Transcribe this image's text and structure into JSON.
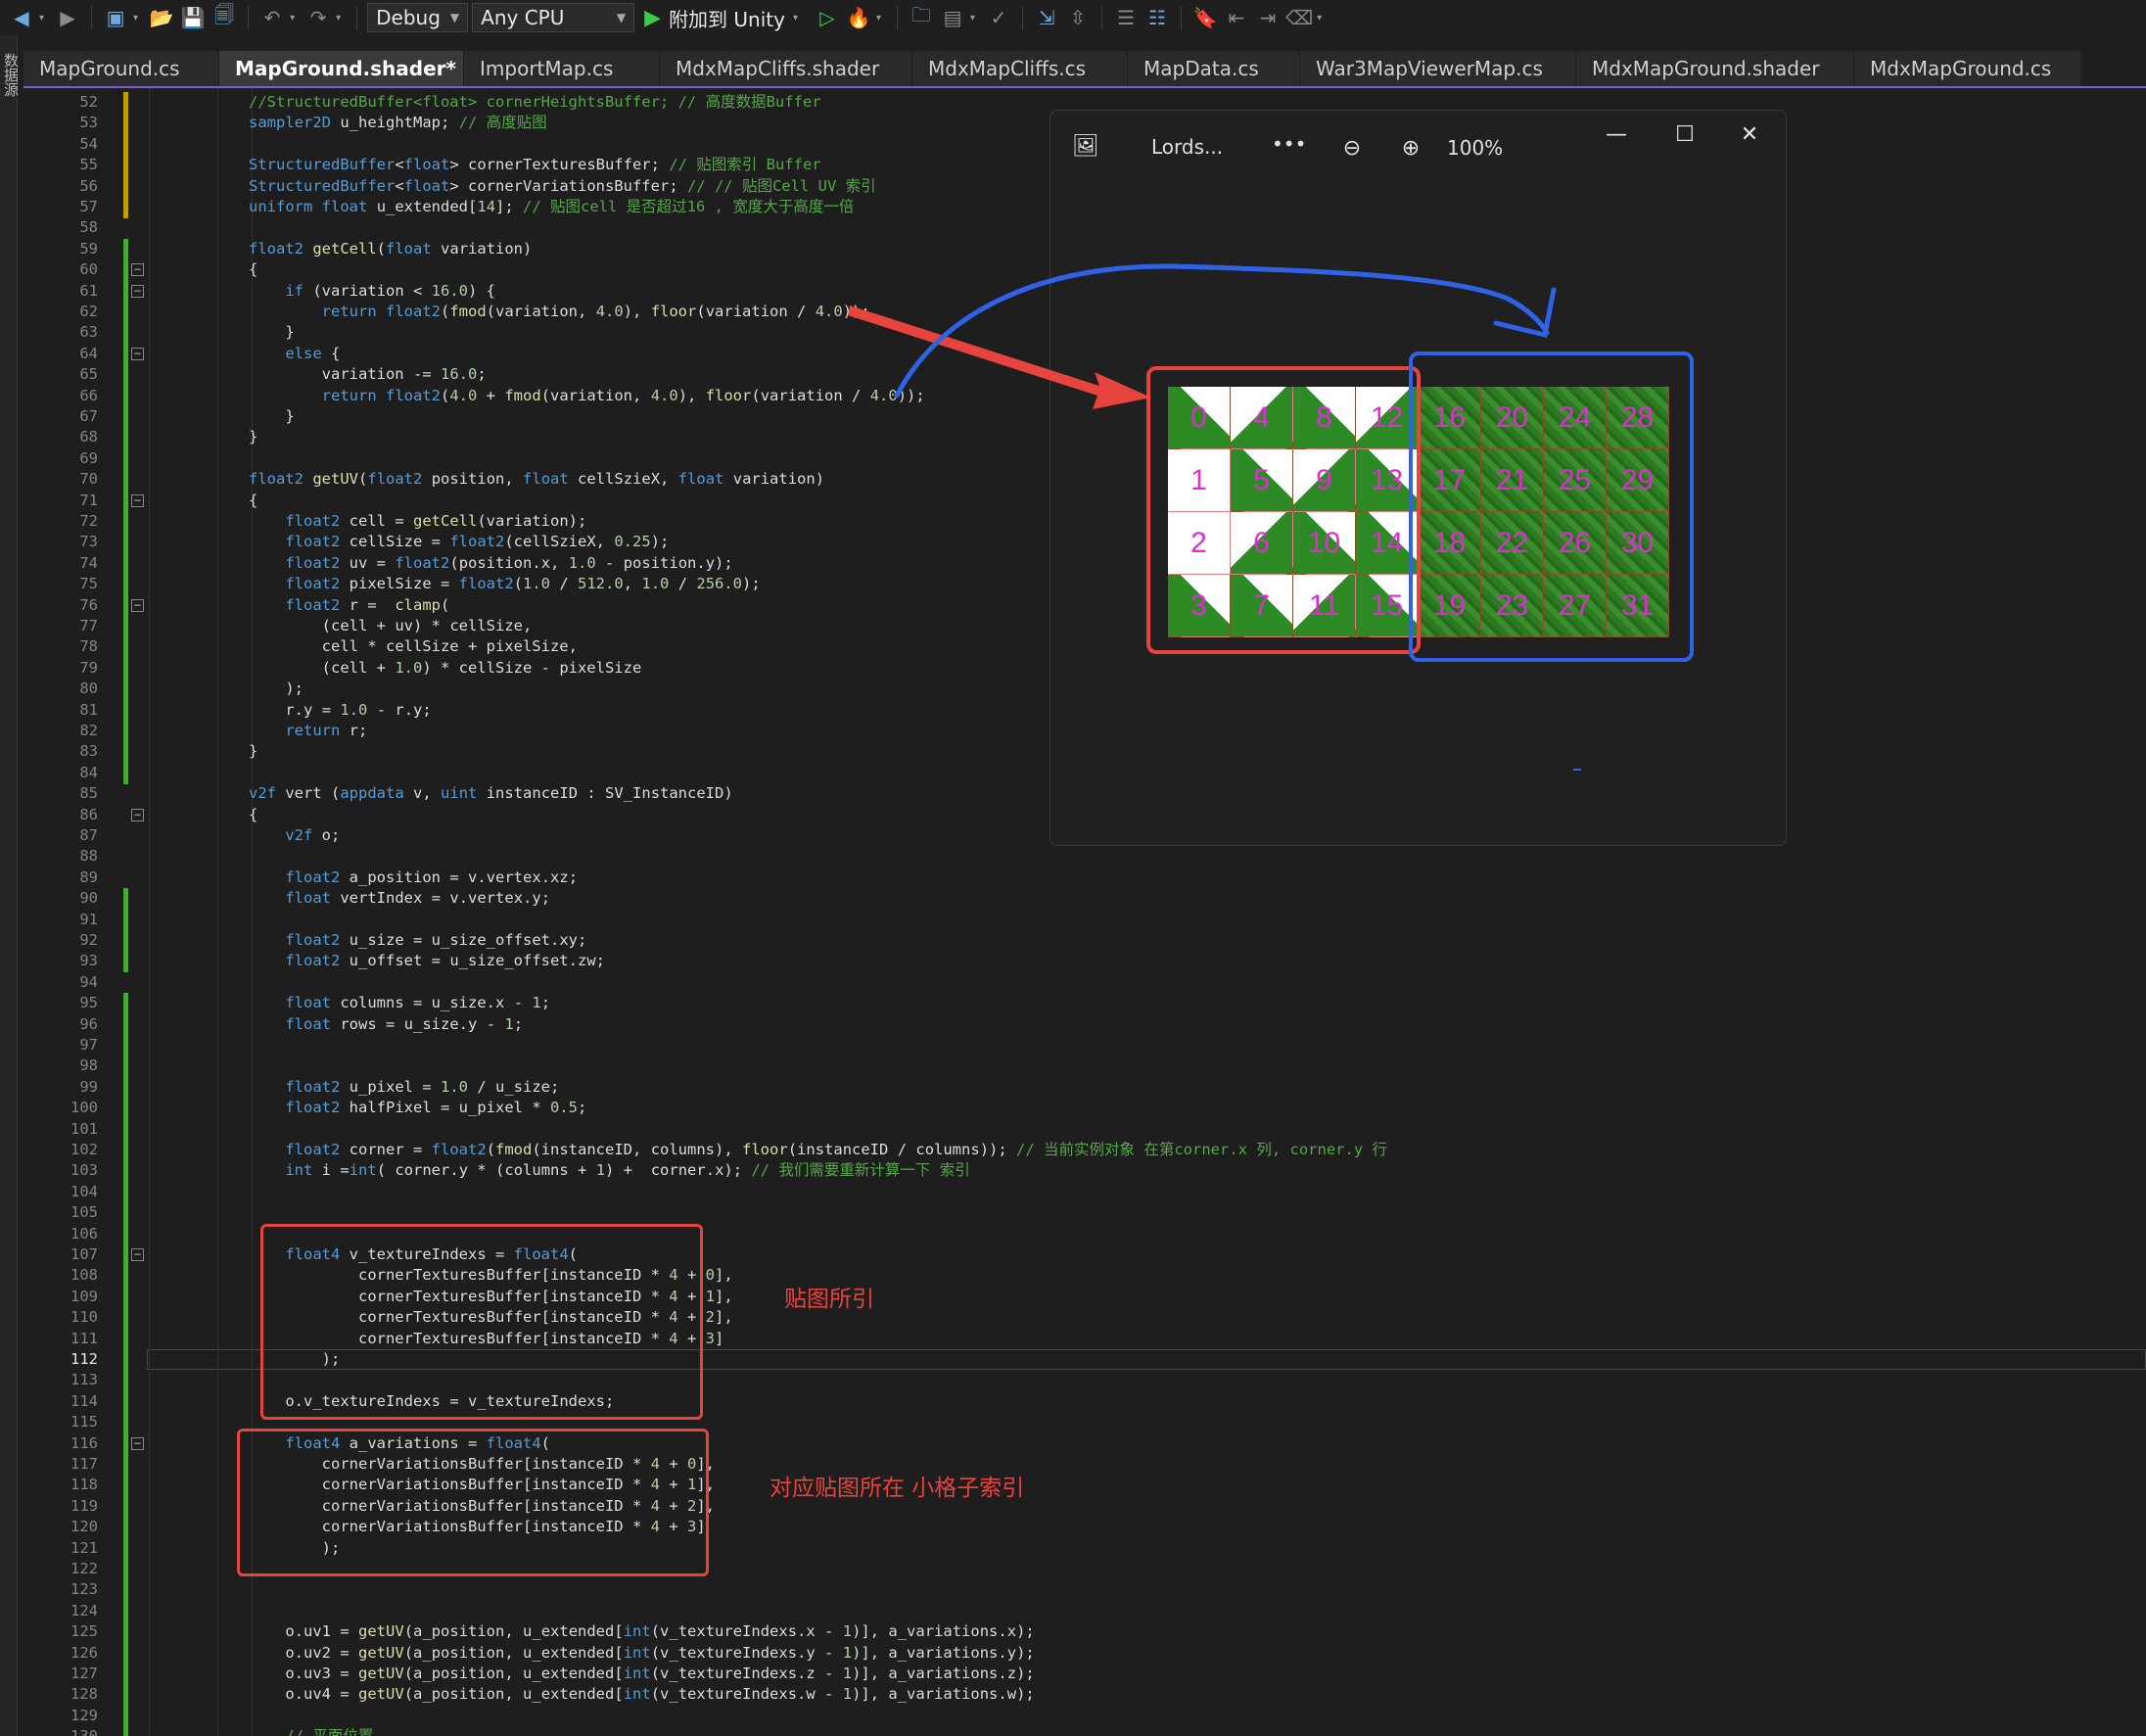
{
  "toolbar": {
    "config": "Debug",
    "platform": "Any CPU",
    "attach": "附加到 Unity"
  },
  "left_strip": {
    "label": "数据源"
  },
  "tabs": [
    {
      "label": "MapGround.cs"
    },
    {
      "label": "MapGround.shader*",
      "active": true
    },
    {
      "label": "ImportMap.cs"
    },
    {
      "label": "MdxMapCliffs.shader"
    },
    {
      "label": "MdxMapCliffs.cs"
    },
    {
      "label": "MapData.cs"
    },
    {
      "label": "War3MapViewerMap.cs"
    },
    {
      "label": "MdxMapGround.shader"
    },
    {
      "label": "MdxMapGround.cs"
    }
  ],
  "editor": {
    "current_line": 112,
    "lines": [
      {
        "n": 52,
        "s": "c",
        "t": "//StructuredBuffer<float> cornerHeightsBuffer; // 高度数据Buffer"
      },
      {
        "n": 53,
        "t": "sampler2D u_heightMap; // 高度贴图"
      },
      {
        "n": 54,
        "t": ""
      },
      {
        "n": 55,
        "t": "StructuredBuffer<float> cornerTexturesBuffer; // 贴图索引 Buffer"
      },
      {
        "n": 56,
        "t": "StructuredBuffer<float> cornerVariationsBuffer; // // 贴图Cell UV 索引"
      },
      {
        "n": 57,
        "t": "uniform float u_extended[14]; // 贴图cell 是否超过16 , 宽度大于高度一倍"
      },
      {
        "n": 58,
        "t": ""
      },
      {
        "n": 59,
        "t": "float2 getCell(float variation)"
      },
      {
        "n": 60,
        "t": "{"
      },
      {
        "n": 61,
        "t": "    if (variation < 16.0) {"
      },
      {
        "n": 62,
        "t": "        return float2(fmod(variation, 4.0), floor(variation / 4.0));"
      },
      {
        "n": 63,
        "t": "    }"
      },
      {
        "n": 64,
        "t": "    else {"
      },
      {
        "n": 65,
        "t": "        variation -= 16.0;"
      },
      {
        "n": 66,
        "t": "        return float2(4.0 + fmod(variation, 4.0), floor(variation / 4.0));"
      },
      {
        "n": 67,
        "t": "    }"
      },
      {
        "n": 68,
        "t": "}"
      },
      {
        "n": 69,
        "t": ""
      },
      {
        "n": 70,
        "t": "float2 getUV(float2 position, float cellSzieX, float variation)"
      },
      {
        "n": 71,
        "t": "{"
      },
      {
        "n": 72,
        "t": "    float2 cell = getCell(variation);"
      },
      {
        "n": 73,
        "t": "    float2 cellSize = float2(cellSzieX, 0.25);"
      },
      {
        "n": 74,
        "t": "    float2 uv = float2(position.x, 1.0 - position.y);"
      },
      {
        "n": 75,
        "t": "    float2 pixelSize = float2(1.0 / 512.0, 1.0 / 256.0);"
      },
      {
        "n": 76,
        "t": "    float2 r =  clamp("
      },
      {
        "n": 77,
        "t": "        (cell + uv) * cellSize,"
      },
      {
        "n": 78,
        "t": "        cell * cellSize + pixelSize,"
      },
      {
        "n": 79,
        "t": "        (cell + 1.0) * cellSize - pixelSize"
      },
      {
        "n": 80,
        "t": "    );"
      },
      {
        "n": 81,
        "t": "    r.y = 1.0 - r.y;"
      },
      {
        "n": 82,
        "t": "    return r;"
      },
      {
        "n": 83,
        "t": "}"
      },
      {
        "n": 84,
        "t": ""
      },
      {
        "n": 85,
        "t": "v2f vert (appdata v, uint instanceID : SV_InstanceID)"
      },
      {
        "n": 86,
        "t": "{"
      },
      {
        "n": 87,
        "t": "    v2f o;"
      },
      {
        "n": 88,
        "t": ""
      },
      {
        "n": 89,
        "t": "    float2 a_position = v.vertex.xz;"
      },
      {
        "n": 90,
        "t": "    float vertIndex = v.vertex.y;"
      },
      {
        "n": 91,
        "t": ""
      },
      {
        "n": 92,
        "t": "    float2 u_size = u_size_offset.xy;"
      },
      {
        "n": 93,
        "t": "    float2 u_offset = u_size_offset.zw;"
      },
      {
        "n": 94,
        "t": ""
      },
      {
        "n": 95,
        "t": "    float columns = u_size.x - 1;"
      },
      {
        "n": 96,
        "t": "    float rows = u_size.y - 1;"
      },
      {
        "n": 97,
        "t": ""
      },
      {
        "n": 98,
        "t": ""
      },
      {
        "n": 99,
        "t": "    float2 u_pixel = 1.0 / u_size;"
      },
      {
        "n": 100,
        "t": "    float2 halfPixel = u_pixel * 0.5;"
      },
      {
        "n": 101,
        "t": ""
      },
      {
        "n": 102,
        "t": "    float2 corner = float2(fmod(instanceID, columns), floor(instanceID / columns)); // 当前实例对象 在第corner.x 列, corner.y 行"
      },
      {
        "n": 103,
        "t": "    int i =int( corner.y * (columns + 1) +  corner.x); // 我们需要重新计算一下 索引"
      },
      {
        "n": 104,
        "t": ""
      },
      {
        "n": 105,
        "t": ""
      },
      {
        "n": 106,
        "t": ""
      },
      {
        "n": 107,
        "t": "    float4 v_textureIndexs = float4("
      },
      {
        "n": 108,
        "t": "            cornerTexturesBuffer[instanceID * 4 + 0],"
      },
      {
        "n": 109,
        "t": "            cornerTexturesBuffer[instanceID * 4 + 1],"
      },
      {
        "n": 110,
        "t": "            cornerTexturesBuffer[instanceID * 4 + 2],"
      },
      {
        "n": 111,
        "t": "            cornerTexturesBuffer[instanceID * 4 + 3]"
      },
      {
        "n": 112,
        "t": "        );"
      },
      {
        "n": 113,
        "t": ""
      },
      {
        "n": 114,
        "t": "    o.v_textureIndexs = v_textureIndexs;"
      },
      {
        "n": 115,
        "t": ""
      },
      {
        "n": 116,
        "t": "    float4 a_variations = float4("
      },
      {
        "n": 117,
        "t": "        cornerVariationsBuffer[instanceID * 4 + 0],"
      },
      {
        "n": 118,
        "t": "        cornerVariationsBuffer[instanceID * 4 + 1],"
      },
      {
        "n": 119,
        "t": "        cornerVariationsBuffer[instanceID * 4 + 2],"
      },
      {
        "n": 120,
        "t": "        cornerVariationsBuffer[instanceID * 4 + 3]"
      },
      {
        "n": 121,
        "t": "        );"
      },
      {
        "n": 122,
        "t": ""
      },
      {
        "n": 123,
        "t": ""
      },
      {
        "n": 124,
        "t": ""
      },
      {
        "n": 125,
        "t": "    o.uv1 = getUV(a_position, u_extended[int(v_textureIndexs.x - 1)], a_variations.x);"
      },
      {
        "n": 126,
        "t": "    o.uv2 = getUV(a_position, u_extended[int(v_textureIndexs.y - 1)], a_variations.y);"
      },
      {
        "n": 127,
        "t": "    o.uv3 = getUV(a_position, u_extended[int(v_textureIndexs.z - 1)], a_variations.z);"
      },
      {
        "n": 128,
        "t": "    o.uv4 = getUV(a_position, u_extended[int(v_textureIndexs.w - 1)], a_variations.w);"
      },
      {
        "n": 129,
        "t": ""
      },
      {
        "n": 130,
        "t": "    // 平面位置"
      }
    ]
  },
  "annotations": {
    "texture_index_label": "贴图所引",
    "variation_index_label": "对应贴图所在 小格子索引"
  },
  "viewer": {
    "title": "Lords...",
    "more": "•••",
    "zoom": "100%",
    "cells": [
      "0",
      "1",
      "2",
      "3",
      "4",
      "5",
      "6",
      "7",
      "8",
      "9",
      "10",
      "11",
      "12",
      "13",
      "14",
      "15",
      "16",
      "17",
      "18",
      "19",
      "20",
      "21",
      "22",
      "23",
      "24",
      "25",
      "26",
      "27",
      "28",
      "29",
      "30",
      "31"
    ]
  },
  "colors": {
    "annotation_red": "#e8443f",
    "arrow_blue": "#2f62e6",
    "cell_label": "#dd2fd0"
  }
}
